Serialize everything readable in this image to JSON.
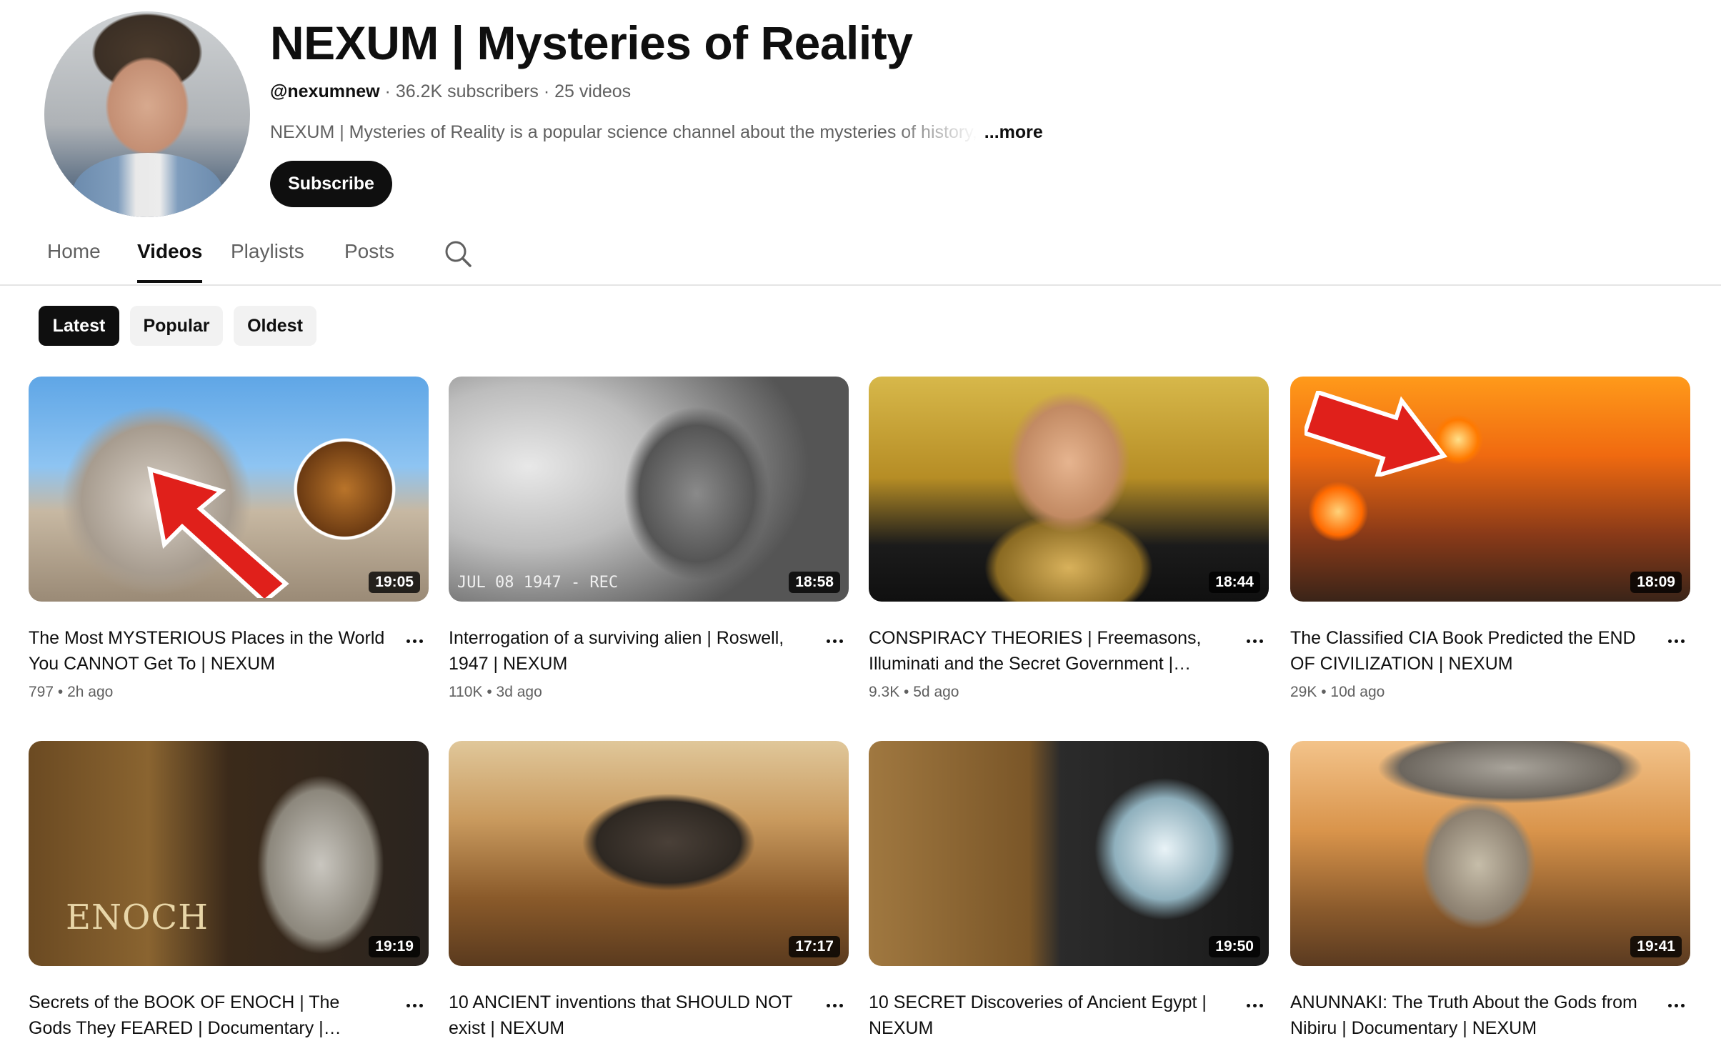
{
  "channel": {
    "name": "NEXUM | Mysteries of Reality",
    "handle": "@nexumnew",
    "subscribers": "36.2K subscribers",
    "videos_count": "25 videos",
    "separator": "·",
    "description": "NEXUM | Mysteries of Reality is a popular science channel about the mysteries of history,",
    "more_label": "...more",
    "subscribe_label": "Subscribe"
  },
  "tabs": [
    {
      "label": "Home"
    },
    {
      "label": "Videos"
    },
    {
      "label": "Playlists"
    },
    {
      "label": "Posts"
    }
  ],
  "active_tab": "Videos",
  "chips": [
    {
      "label": "Latest"
    },
    {
      "label": "Popular"
    },
    {
      "label": "Oldest"
    }
  ],
  "active_chip": "Latest",
  "videos": [
    {
      "title": "The Most MYSTERIOUS Places in the World You CANNOT Get To | NEXUM",
      "duration": "19:05",
      "views": "797",
      "age": "2h ago",
      "thumb": "t1"
    },
    {
      "title": "Interrogation of a surviving alien | Roswell, 1947 | NEXUM",
      "duration": "18:58",
      "views": "110K",
      "age": "3d ago",
      "thumb": "t2",
      "overlay_text": "JUL 08 1947 - REC"
    },
    {
      "title": "CONSPIRACY THEORIES | Freemasons, Illuminati and the Secret Government | NEXUM",
      "duration": "18:44",
      "views": "9.3K",
      "age": "5d ago",
      "thumb": "t3"
    },
    {
      "title": "The Classified CIA Book Predicted the END OF CIVILIZATION | NEXUM",
      "duration": "18:09",
      "views": "29K",
      "age": "10d ago",
      "thumb": "t4"
    },
    {
      "title": "Secrets of the BOOK OF ENOCH | The Gods They FEARED | Documentary | NEXUM",
      "duration": "19:19",
      "thumb": "t5",
      "overlay_text": "ENOCH"
    },
    {
      "title": "10 ANCIENT inventions that SHOULD NOT exist | NEXUM",
      "duration": "17:17",
      "thumb": "t6"
    },
    {
      "title": "10 SECRET Discoveries of Ancient Egypt | NEXUM",
      "duration": "19:50",
      "thumb": "t7"
    },
    {
      "title": "ANUNNAKI: The Truth About the Gods from Nibiru | Documentary | NEXUM",
      "duration": "19:41",
      "thumb": "t8"
    }
  ],
  "stats_separator": "•",
  "icons": {
    "search": "search-icon",
    "more": "more-vert-icon"
  },
  "colors": {
    "primary_text": "#0f0f0f",
    "secondary_text": "#606060",
    "chip_bg": "#f2f2f2",
    "active_chip_bg": "#0f0f0f"
  }
}
